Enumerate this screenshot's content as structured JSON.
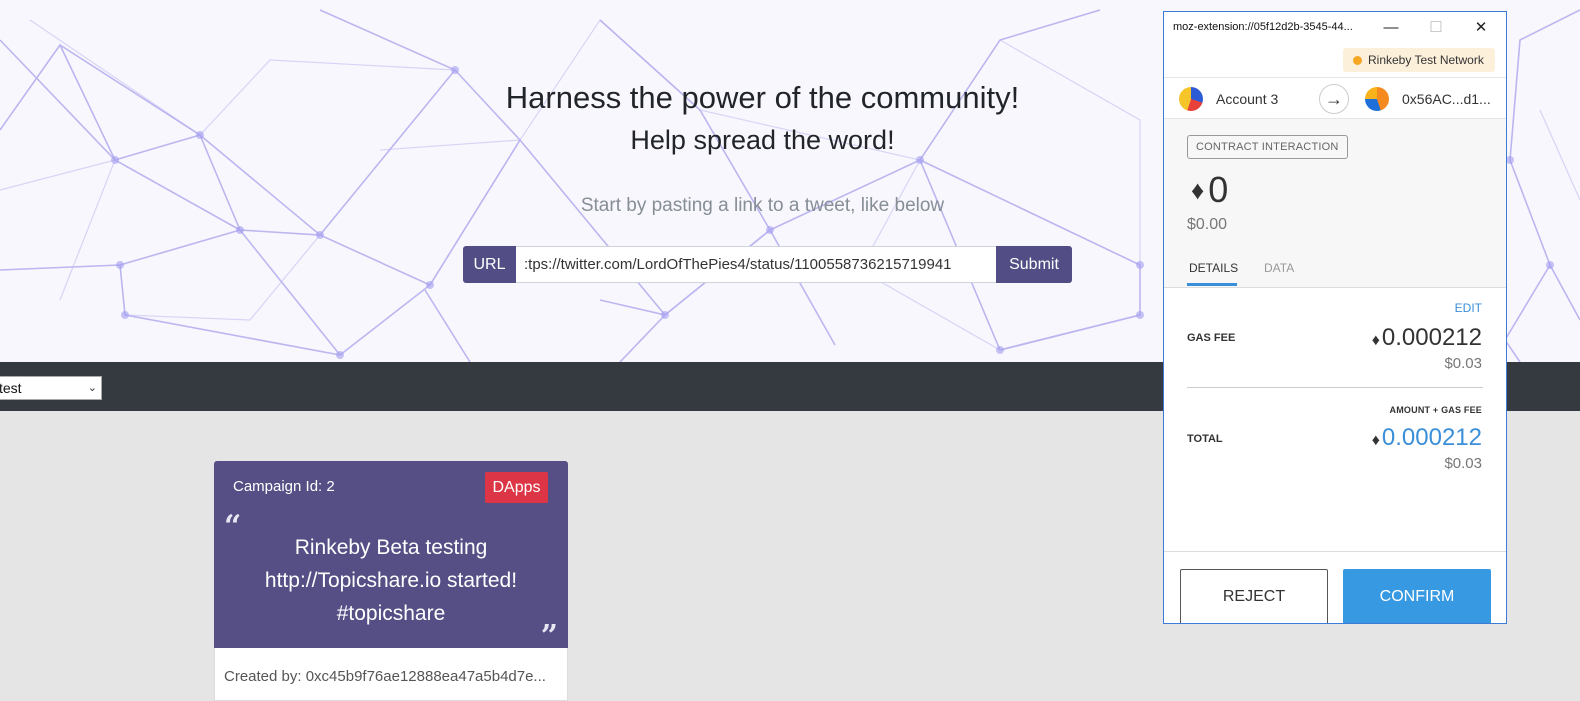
{
  "hero": {
    "title": "Harness the power of the community!",
    "subtitle": "Help spread the word!",
    "hint": "Start by pasting a link to a tweet, like below",
    "url_label": "URL",
    "url_value": ":tps://twitter.com/LordOfThePies4/status/1100558736215719941",
    "submit_label": "Submit"
  },
  "filter": {
    "selected": "test"
  },
  "card": {
    "campaign_id": "Campaign Id: 2",
    "badge": "DApps",
    "tweet_line1": "Rinkeby Beta testing",
    "tweet_line2": "http://Topicshare.io  started!",
    "tweet_line3": "#topicshare",
    "created_by": "Created by: 0xc45b9f76ae12888ea47a5b4d7e..."
  },
  "metamask": {
    "window_title": "moz-extension://05f12d2b-3545-44...",
    "network": "Rinkeby Test Network",
    "from_account": "Account 3",
    "to_address": "0x56AC...d1...",
    "tag": "CONTRACT INTERACTION",
    "amount": "0",
    "amount_fiat": "$0.00",
    "tabs": {
      "details": "DETAILS",
      "data": "DATA"
    },
    "edit_label": "EDIT",
    "gas_fee_label": "GAS FEE",
    "gas_fee_value": "0.000212",
    "gas_fee_fiat": "$0.03",
    "amount_gas_label": "AMOUNT + GAS FEE",
    "total_label": "TOTAL",
    "total_value": "0.000212",
    "total_fiat": "$0.03",
    "reject_label": "REJECT",
    "confirm_label": "CONFIRM"
  },
  "colors": {
    "brand_purple": "#554f85",
    "badge_red": "#dc3545",
    "dark_bar": "#343a40",
    "metamask_blue": "#3699e2",
    "network_dot": "#f5a623"
  }
}
